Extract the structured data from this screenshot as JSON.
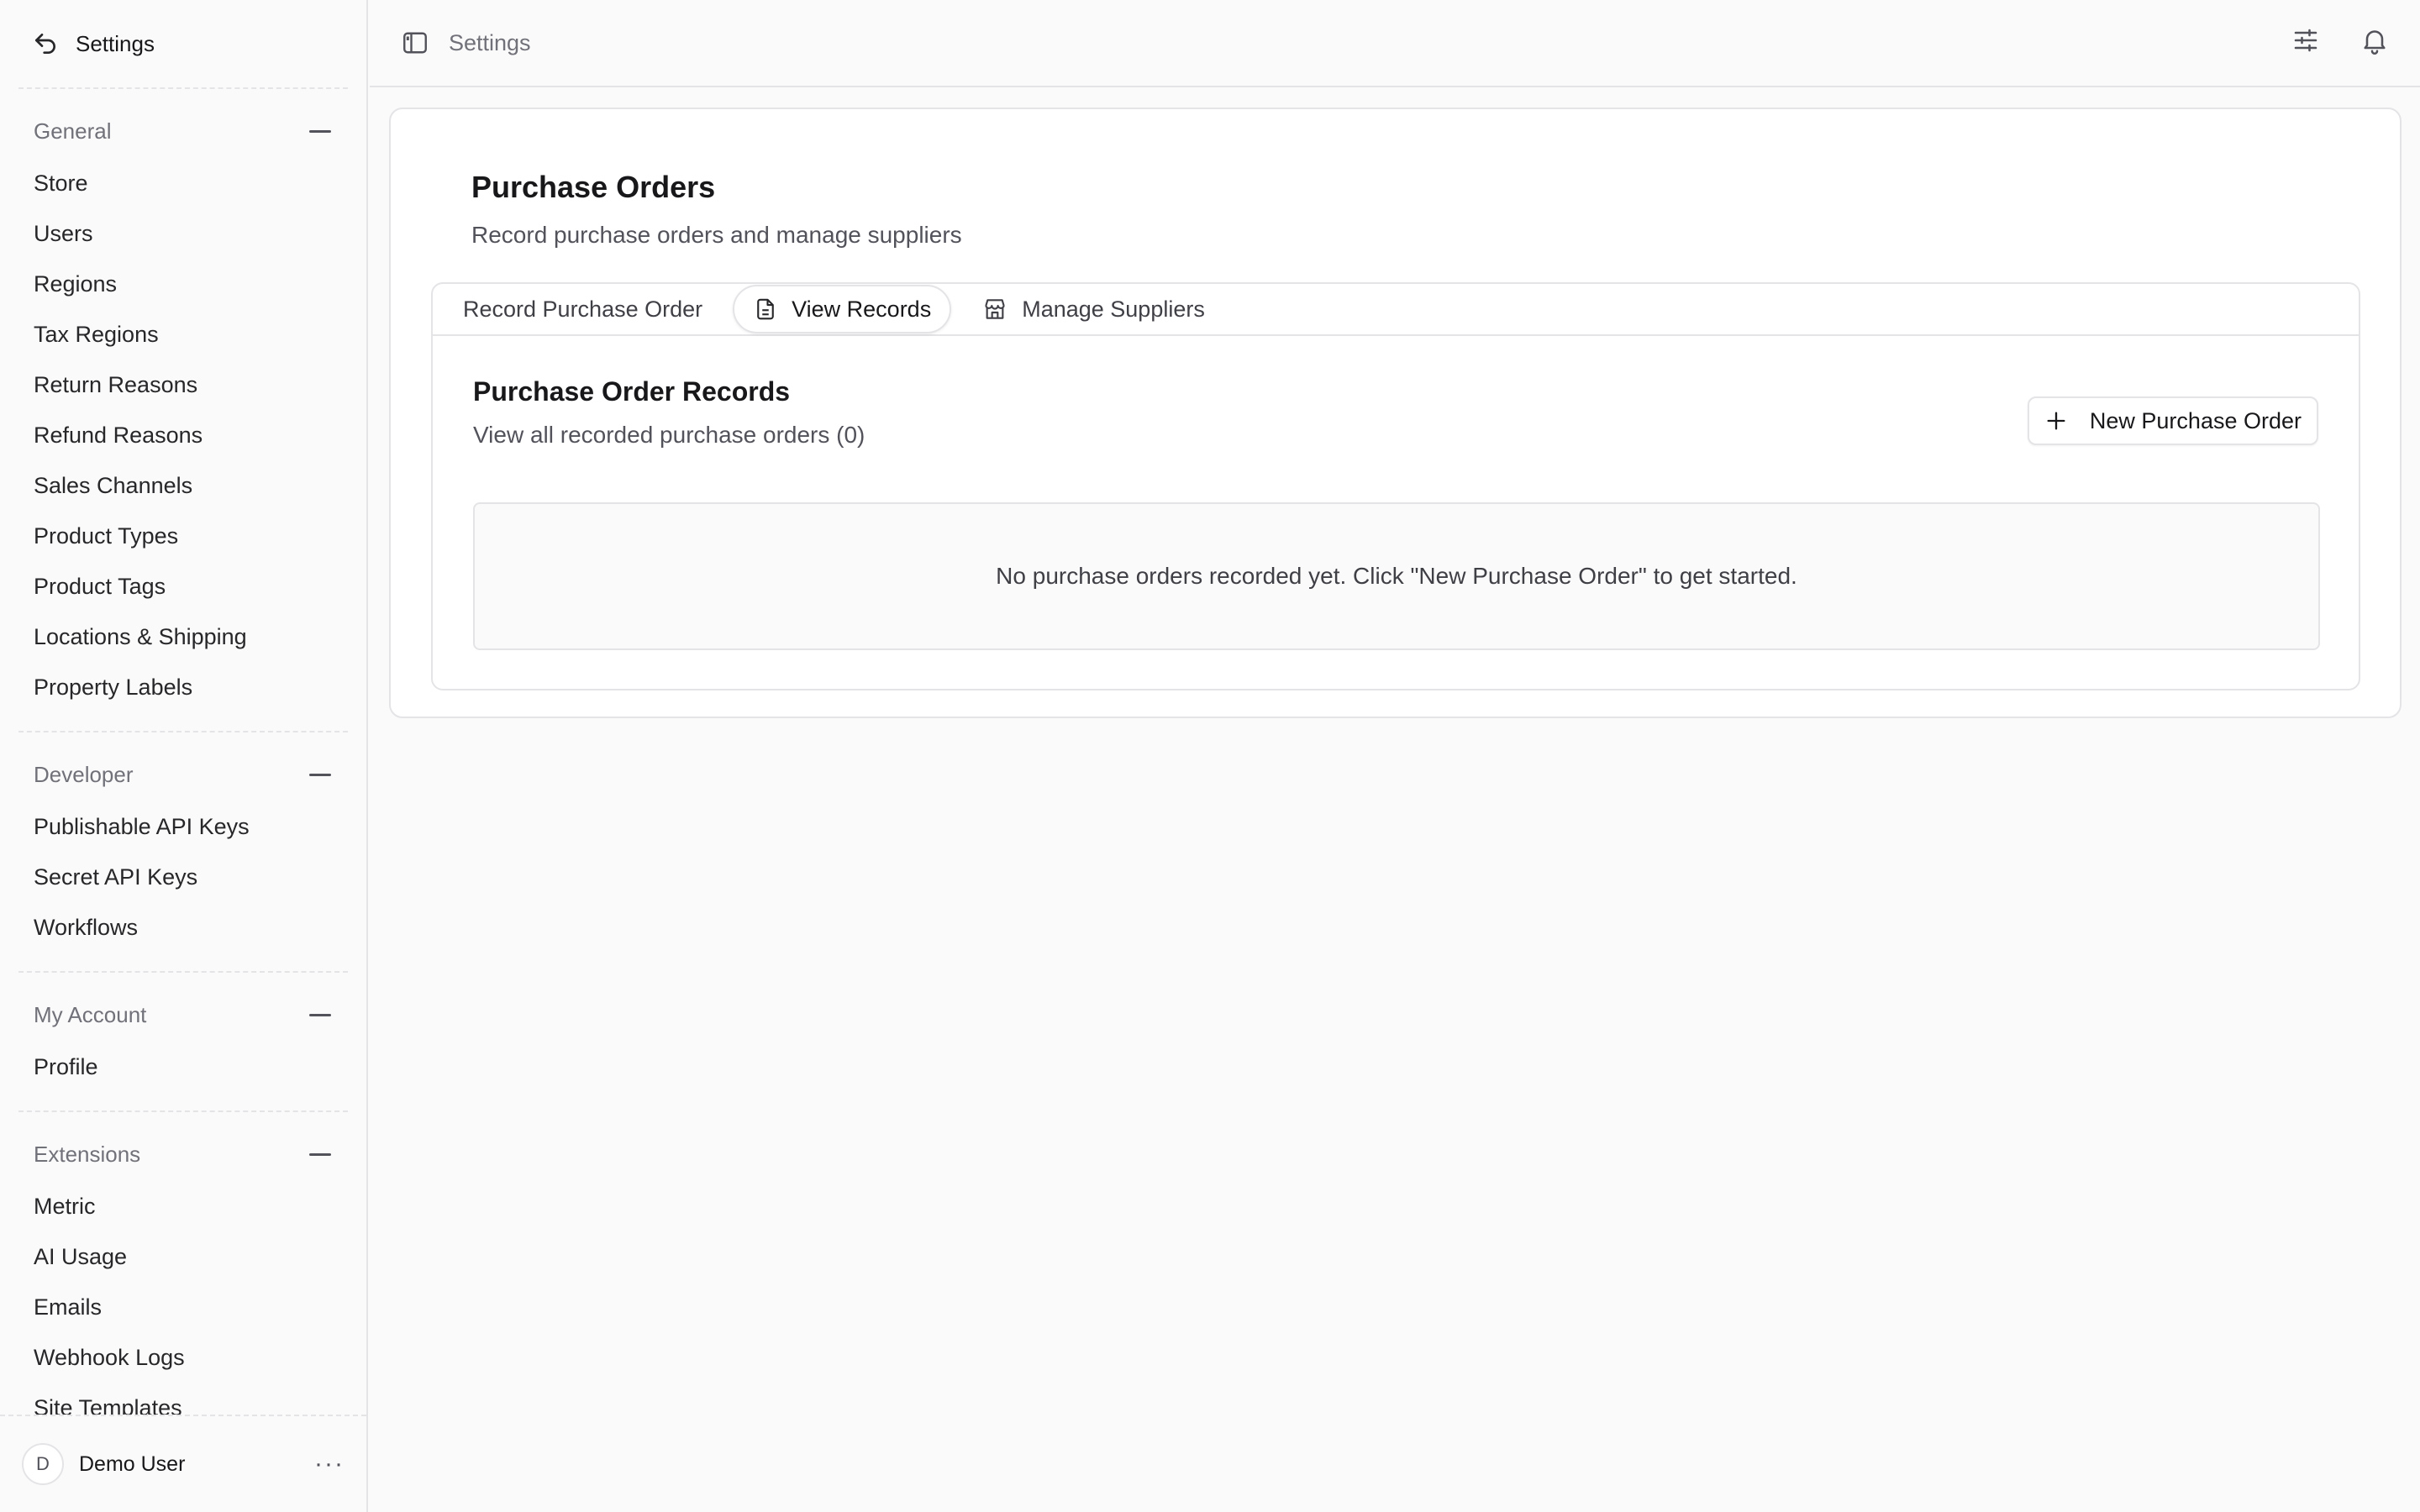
{
  "sidebar": {
    "title": "Settings",
    "sections": [
      {
        "heading": "General",
        "items": [
          "Store",
          "Users",
          "Regions",
          "Tax Regions",
          "Return Reasons",
          "Refund Reasons",
          "Sales Channels",
          "Product Types",
          "Product Tags",
          "Locations & Shipping",
          "Property Labels"
        ]
      },
      {
        "heading": "Developer",
        "items": [
          "Publishable API Keys",
          "Secret API Keys",
          "Workflows"
        ]
      },
      {
        "heading": "My Account",
        "items": [
          "Profile"
        ]
      },
      {
        "heading": "Extensions",
        "items": [
          "Metric",
          "AI Usage",
          "Emails",
          "Webhook Logs",
          "Site Templates"
        ]
      }
    ],
    "user": {
      "initial": "D",
      "name": "Demo User"
    }
  },
  "topbar": {
    "breadcrumb": "Settings"
  },
  "page": {
    "title": "Purchase Orders",
    "subtitle": "Record purchase orders and manage suppliers",
    "tabs": [
      {
        "label": "Record Purchase Order",
        "active": false
      },
      {
        "label": "View Records",
        "active": true
      },
      {
        "label": "Manage Suppliers",
        "active": false
      }
    ],
    "records": {
      "title": "Purchase Order Records",
      "subtitle": "View all recorded purchase orders (0)",
      "new_button": "New Purchase Order",
      "empty_message": "No purchase orders recorded yet. Click \"New Purchase Order\" to get started."
    }
  },
  "icons": {
    "back": "arrow-back-icon",
    "sidebar_toggle": "sidebar-toggle-icon",
    "filters": "sliders-icon",
    "bell": "bell-icon",
    "document": "document-icon",
    "store": "store-icon",
    "plus": "plus-icon"
  }
}
